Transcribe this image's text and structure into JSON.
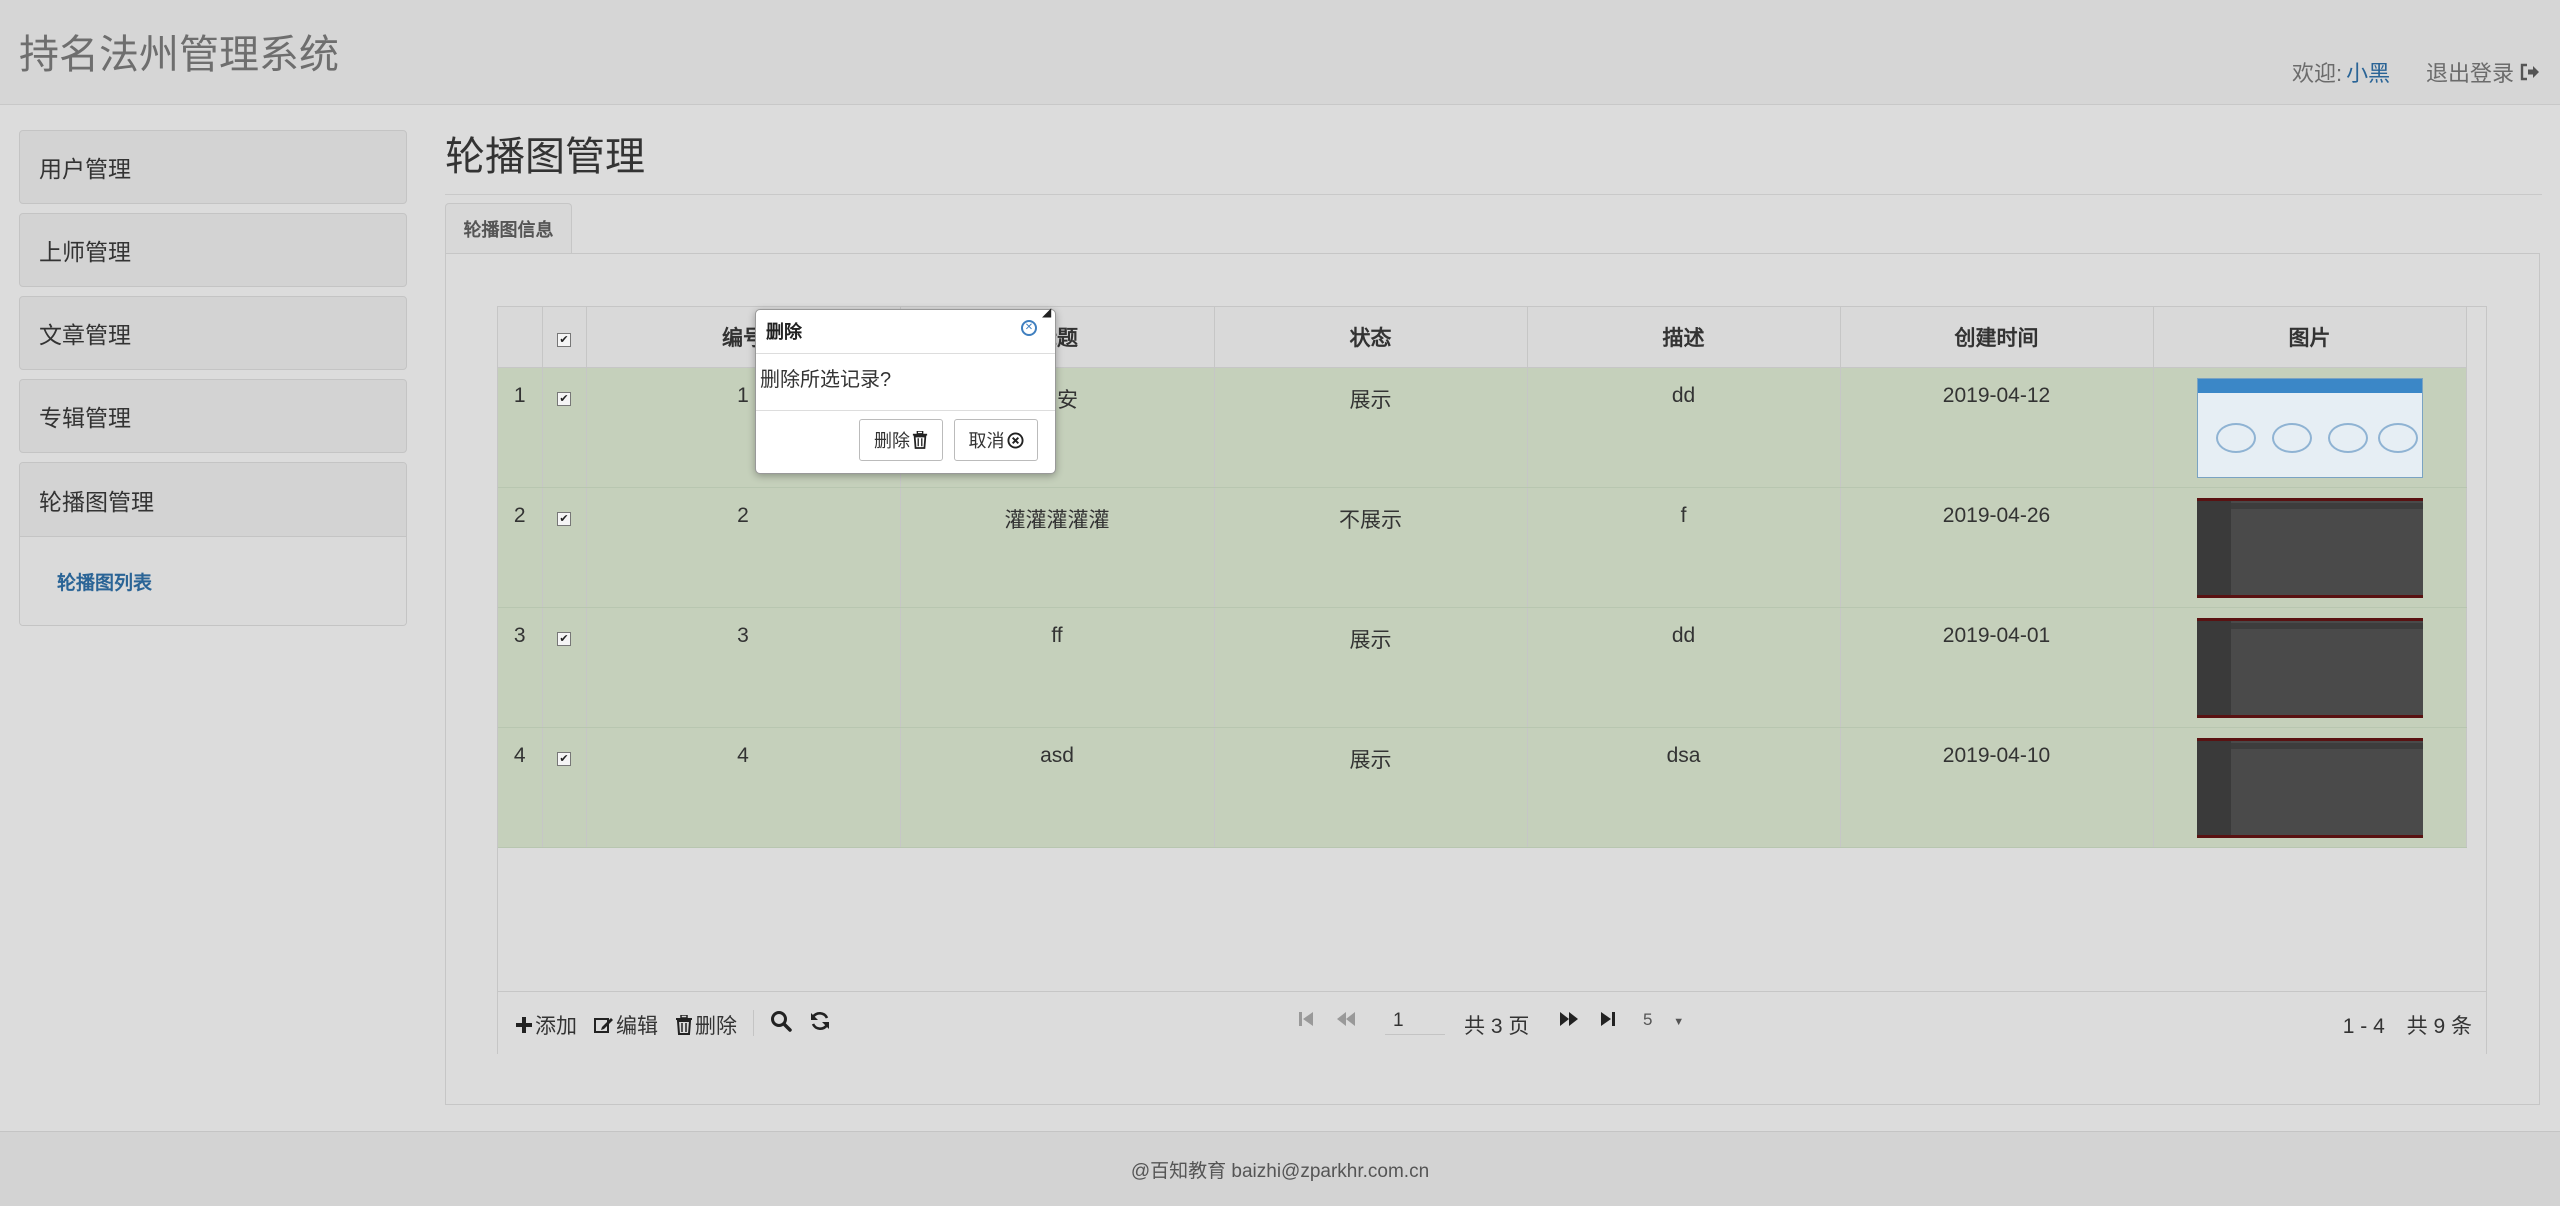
{
  "header": {
    "title": "持名法州管理系统",
    "welcome_label": "欢迎:",
    "username": "小黑",
    "logout_label": "退出登录"
  },
  "sidebar": {
    "items": [
      {
        "label": "用户管理"
      },
      {
        "label": "上师管理"
      },
      {
        "label": "文章管理"
      },
      {
        "label": "专辑管理"
      },
      {
        "label": "轮播图管理"
      }
    ],
    "sub_item": "轮播图列表"
  },
  "main": {
    "title": "轮播图管理",
    "tab": "轮播图信息"
  },
  "table": {
    "columns": [
      "编号",
      "标题",
      "状态",
      "描述",
      "创建时间",
      "图片"
    ],
    "rows": [
      {
        "rownum": "1",
        "id": "1",
        "title": "安安",
        "status": "展示",
        "desc": "dd",
        "created": "2019-04-12"
      },
      {
        "rownum": "2",
        "id": "2",
        "title": "灌灌灌灌灌",
        "status": "不展示",
        "desc": "f",
        "created": "2019-04-26"
      },
      {
        "rownum": "3",
        "id": "3",
        "title": "ff",
        "status": "展示",
        "desc": "dd",
        "created": "2019-04-01"
      },
      {
        "rownum": "4",
        "id": "4",
        "title": "asd",
        "status": "展示",
        "desc": "dsa",
        "created": "2019-04-10"
      }
    ]
  },
  "toolbar": {
    "add_label": "添加",
    "edit_label": "编辑",
    "delete_label": "删除",
    "current_page": "1",
    "total_pages": "共 3 页",
    "page_size": "5",
    "range": "1 - 4",
    "total_records": "共 9 条"
  },
  "dialog": {
    "title": "删除",
    "message": "删除所选记录?",
    "confirm_label": "删除",
    "cancel_label": "取消"
  },
  "footer": {
    "text": "@百知教育 baizhi@zparkhr.com.cn"
  },
  "colors": {
    "row_selected": "#c5d0bb",
    "link": "#2a6496"
  }
}
